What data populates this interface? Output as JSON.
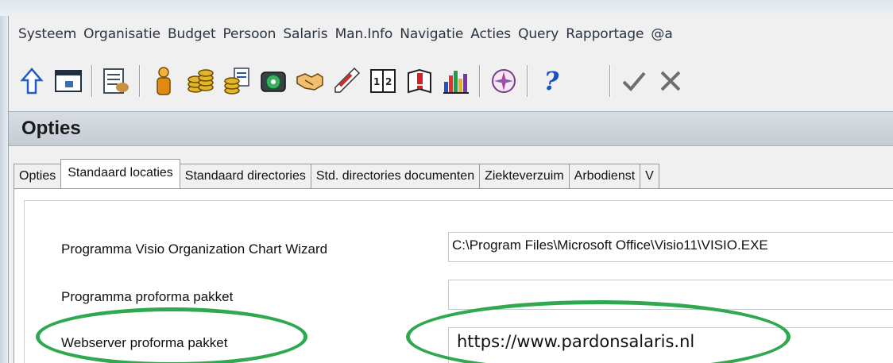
{
  "menu": [
    "Systeem",
    "Organisatie",
    "Budget",
    "Persoon",
    "Salaris",
    "Man.Info",
    "Navigatie",
    "Acties",
    "Query",
    "Rapportage",
    "@a"
  ],
  "toolbar": {
    "icons": [
      {
        "name": "up-arrow-icon",
        "glyph": "⇧",
        "color": "#1f5fbf"
      },
      {
        "name": "window-icon",
        "glyph": "▭",
        "color": "#304050"
      },
      {
        "name": "form-handshake-icon",
        "glyph": "📋",
        "color": "#506070"
      },
      {
        "name": "person-icon",
        "glyph": "👤",
        "color": "#d08a10"
      },
      {
        "name": "coins-icon",
        "glyph": "🪙",
        "color": "#b89000"
      },
      {
        "name": "coins-document-icon",
        "glyph": "💰",
        "color": "#a08000"
      },
      {
        "name": "cd-globe-icon",
        "glyph": "💿",
        "color": "#208040"
      },
      {
        "name": "handshake-icon",
        "glyph": "🤝",
        "color": "#c09030"
      },
      {
        "name": "thermometer-icon",
        "glyph": "🌡",
        "color": "#c03030"
      },
      {
        "name": "calendar-book-icon",
        "glyph": "📖",
        "color": "#404040"
      },
      {
        "name": "alert-book-icon",
        "glyph": "❗",
        "color": "#d02020"
      },
      {
        "name": "bar-chart-icon",
        "glyph": "📊",
        "color": "#2040c0"
      },
      {
        "name": "compass-icon",
        "glyph": "🧭",
        "color": "#a04090"
      },
      {
        "name": "help-icon",
        "glyph": "?",
        "color": "#1a4fc0"
      },
      {
        "name": "check-icon",
        "glyph": "✓",
        "color": "#707070"
      },
      {
        "name": "close-icon",
        "glyph": "✕",
        "color": "#707070"
      }
    ]
  },
  "title": "Opties",
  "tabs": [
    "Opties",
    "Standaard locaties",
    "Standaard directories",
    "Std. directories documenten",
    "Ziekteverzuim",
    "Arbodienst",
    "V"
  ],
  "active_tab": "Standaard locaties",
  "fields": [
    {
      "label": "Programma Visio Organization Chart Wizard",
      "value": "C:\\Program Files\\Microsoft Office\\Visio11\\VISIO.EXE"
    },
    {
      "label": "Programma proforma pakket",
      "value": ""
    },
    {
      "label": "Webserver proforma pakket",
      "value": "https://www.pardonsalaris.nl"
    }
  ],
  "colors": {
    "highlight_ellipse": "#2fa84f",
    "title_bar": "#c5ccd4"
  }
}
